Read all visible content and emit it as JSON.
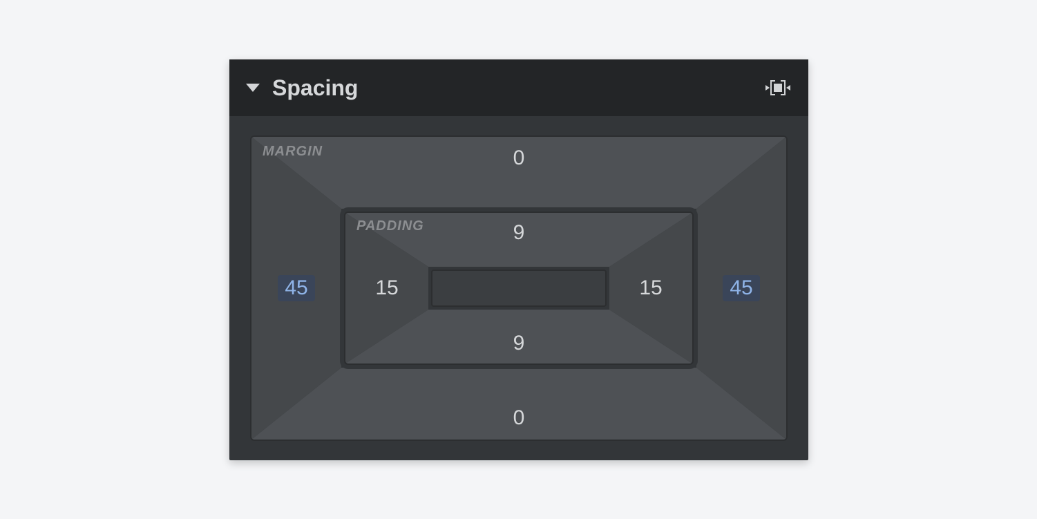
{
  "panel": {
    "title": "Spacing"
  },
  "labels": {
    "margin": "MARGIN",
    "padding": "PADDING"
  },
  "margin": {
    "top": "0",
    "right": "45",
    "bottom": "0",
    "left": "45",
    "right_highlighted": true,
    "left_highlighted": true
  },
  "padding": {
    "top": "9",
    "right": "15",
    "bottom": "9",
    "left": "15"
  }
}
